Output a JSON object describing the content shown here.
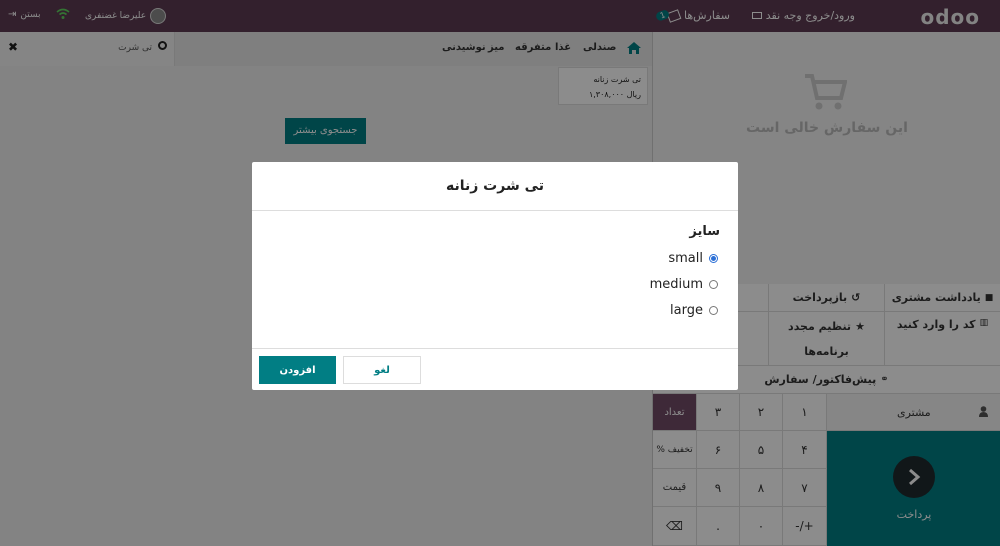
{
  "topbar": {
    "logo": "odoo",
    "cash_in_out": "ورود/خروج وجه نقد",
    "orders_label": "سفارش‌ها",
    "orders_count": "1",
    "user_name": "علیرضا غضنفری",
    "close_label": "بستن"
  },
  "left": {
    "categories": [
      "صندلی",
      "غذا",
      "متفرقه",
      "میز",
      "نوشیدنی"
    ],
    "search_value": "تی شرت",
    "product": {
      "name": "تی شرت زنانه",
      "price": "۱,۳۰۸,۰۰۰ ریال"
    },
    "more_search": "جستجوی بیشتر"
  },
  "cart": {
    "empty_text": "این سفارش خالی است"
  },
  "controls": {
    "customer_note": "یادداشت مشتری",
    "refund": "بازپرداخت",
    "enter_code": "کد را وارد کنید",
    "reset_programs_1": "تنظیم مجدد",
    "reset_programs_2": "برنامه‌ها",
    "quotation": "پیش‌فاکتور/ سفارش"
  },
  "numpad": {
    "customer": "مشتری",
    "payment": "پرداخت",
    "keys": [
      "۱",
      "۲",
      "۳",
      "تعداد",
      "۴",
      "۵",
      "۶",
      "% تخفیف",
      "۷",
      "۸",
      "۹",
      "قیمت",
      "-/+",
      "۰",
      ".",
      "⌫"
    ]
  },
  "modal": {
    "title": "تی شرت زنانه",
    "attribute": "سایز",
    "options": [
      "small",
      "medium",
      "large"
    ],
    "selected": "small",
    "cancel": "لغو",
    "add": "افزودن"
  },
  "colors": {
    "topbar": "#5d3b52",
    "primary": "#017e84",
    "accent": "#714b67"
  }
}
